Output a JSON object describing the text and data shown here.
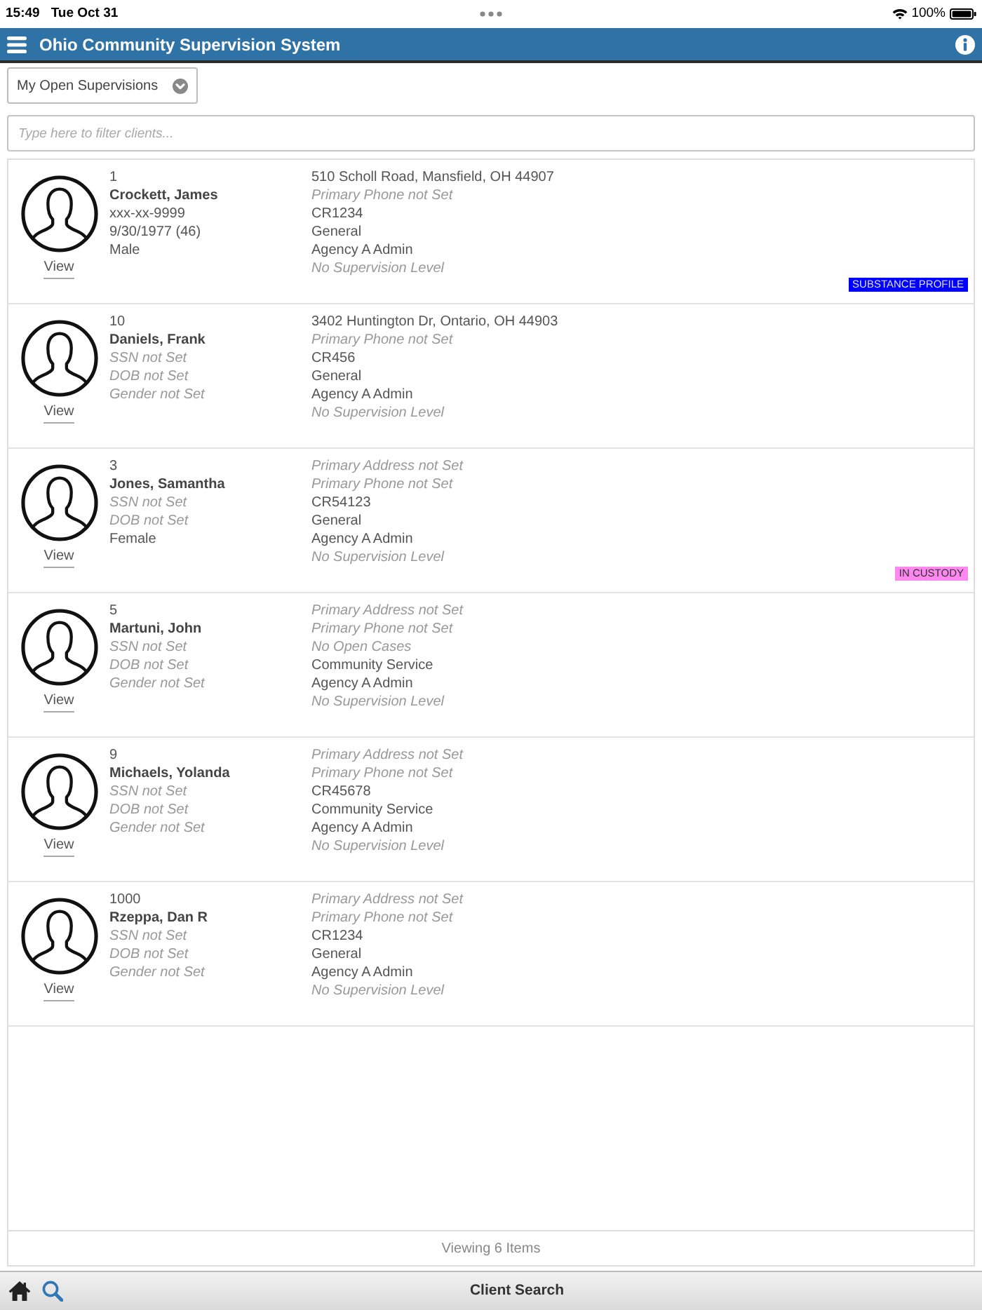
{
  "status_bar": {
    "time": "15:49",
    "date": "Tue Oct 31",
    "battery": "100%"
  },
  "header": {
    "title": "Ohio Community Supervision System"
  },
  "filter_dropdown": {
    "value": "My Open Supervisions"
  },
  "search": {
    "placeholder": "Type here to filter clients..."
  },
  "clients": [
    {
      "number": "1",
      "name": "Crockett, James",
      "details": [
        {
          "text": "xxx-xx-9999",
          "missing": false
        },
        {
          "text": "9/30/1977 (46)",
          "missing": false
        },
        {
          "text": "Male",
          "missing": false
        }
      ],
      "info": [
        {
          "text": "510 Scholl Road, Mansfield, OH 44907",
          "missing": false
        },
        {
          "text": "Primary Phone not Set",
          "missing": true
        },
        {
          "text": "CR1234",
          "missing": false
        },
        {
          "text": "General",
          "missing": false
        },
        {
          "text": "Agency A Admin",
          "missing": false
        },
        {
          "text": "No Supervision Level",
          "missing": true
        }
      ],
      "action": "View",
      "badge": {
        "label": "SUBSTANCE PROFILE",
        "color": "#0000ff"
      }
    },
    {
      "number": "10",
      "name": "Daniels, Frank",
      "details": [
        {
          "text": "SSN not Set",
          "missing": true
        },
        {
          "text": "DOB not Set",
          "missing": true
        },
        {
          "text": "Gender not Set",
          "missing": true
        }
      ],
      "info": [
        {
          "text": "3402 Huntington Dr, Ontario, OH 44903",
          "missing": false
        },
        {
          "text": "Primary Phone not Set",
          "missing": true
        },
        {
          "text": "CR456",
          "missing": false
        },
        {
          "text": "General",
          "missing": false
        },
        {
          "text": "Agency A Admin",
          "missing": false
        },
        {
          "text": "No Supervision Level",
          "missing": true
        }
      ],
      "action": "View"
    },
    {
      "number": "3",
      "name": "Jones, Samantha",
      "details": [
        {
          "text": "SSN not Set",
          "missing": true
        },
        {
          "text": "DOB not Set",
          "missing": true
        },
        {
          "text": "Female",
          "missing": false
        }
      ],
      "info": [
        {
          "text": "Primary Address not Set",
          "missing": true
        },
        {
          "text": "Primary Phone not Set",
          "missing": true
        },
        {
          "text": "CR54123",
          "missing": false
        },
        {
          "text": "General",
          "missing": false
        },
        {
          "text": "Agency A Admin",
          "missing": false
        },
        {
          "text": "No Supervision Level",
          "missing": true
        }
      ],
      "action": "View",
      "badge": {
        "label": "IN CUSTODY",
        "color": "#ff88f0"
      }
    },
    {
      "number": "5",
      "name": "Martuni, John",
      "details": [
        {
          "text": "SSN not Set",
          "missing": true
        },
        {
          "text": "DOB not Set",
          "missing": true
        },
        {
          "text": "Gender not Set",
          "missing": true
        }
      ],
      "info": [
        {
          "text": "Primary Address not Set",
          "missing": true
        },
        {
          "text": "Primary Phone not Set",
          "missing": true
        },
        {
          "text": "No Open Cases",
          "missing": true
        },
        {
          "text": "Community Service",
          "missing": false
        },
        {
          "text": "Agency A Admin",
          "missing": false
        },
        {
          "text": "No Supervision Level",
          "missing": true
        }
      ],
      "action": "View"
    },
    {
      "number": "9",
      "name": "Michaels, Yolanda",
      "details": [
        {
          "text": "SSN not Set",
          "missing": true
        },
        {
          "text": "DOB not Set",
          "missing": true
        },
        {
          "text": "Gender not Set",
          "missing": true
        }
      ],
      "info": [
        {
          "text": "Primary Address not Set",
          "missing": true
        },
        {
          "text": "Primary Phone not Set",
          "missing": true
        },
        {
          "text": "CR45678",
          "missing": false
        },
        {
          "text": "Community Service",
          "missing": false
        },
        {
          "text": "Agency A Admin",
          "missing": false
        },
        {
          "text": "No Supervision Level",
          "missing": true
        }
      ],
      "action": "View"
    },
    {
      "number": "1000",
      "name": "Rzeppa, Dan R",
      "details": [
        {
          "text": "SSN not Set",
          "missing": true
        },
        {
          "text": "DOB not Set",
          "missing": true
        },
        {
          "text": "Gender not Set",
          "missing": true
        }
      ],
      "info": [
        {
          "text": "Primary Address not Set",
          "missing": true
        },
        {
          "text": "Primary Phone not Set",
          "missing": true
        },
        {
          "text": "CR1234",
          "missing": false
        },
        {
          "text": "General",
          "missing": false
        },
        {
          "text": "Agency A Admin",
          "missing": false
        },
        {
          "text": "No Supervision Level",
          "missing": true
        }
      ],
      "action": "View"
    }
  ],
  "footer": {
    "text": "Viewing 6 Items"
  },
  "tab_bar": {
    "title": "Client Search"
  }
}
